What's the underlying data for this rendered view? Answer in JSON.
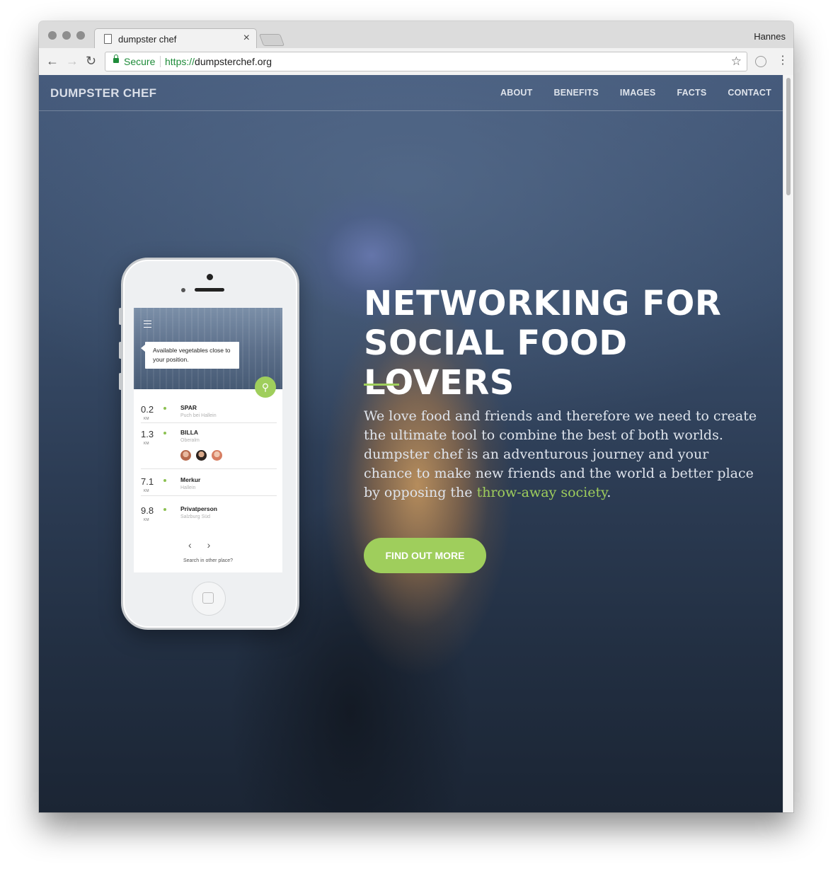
{
  "browser": {
    "tab_title": "dumpster chef",
    "tab_close": "×",
    "profile_name": "Hannes",
    "nav_back": "←",
    "nav_forward": "→",
    "nav_reload": "↻",
    "secure_label": "Secure",
    "url_scheme": "https://",
    "url_host": "dumpsterchef.org",
    "bookmark_icon": "☆",
    "menu_icon": "⋮"
  },
  "site": {
    "brand": "DUMPSTER CHEF",
    "nav": [
      "ABOUT",
      "BENEFITS",
      "IMAGES",
      "FACTS",
      "CONTACT"
    ]
  },
  "app_mockup": {
    "bubble_text": "Available vegetables close to your position.",
    "pin_icon": "⚲",
    "unit": "KM",
    "locations": [
      {
        "distance": "0.2",
        "name": "SPAR",
        "place": "Puch bei Hallein"
      },
      {
        "distance": "1.3",
        "name": "BILLA",
        "place": "Oberalm"
      },
      {
        "distance": "7.1",
        "name": "Merkur",
        "place": "Hallein"
      },
      {
        "distance": "9.8",
        "name": "Privatperson",
        "place": "Salzburg Süd"
      }
    ],
    "prev_icon": "‹",
    "next_icon": "›",
    "search_other": "Search in other place?"
  },
  "hero": {
    "title_line1": "NETWORKING FOR",
    "title_line2": "SOCIAL FOOD LOVERS",
    "text": "We love food and friends and therefore we need to create the ultimate tool to combine the best of both worlds. dumpster chef is an adventurous journey and your chance to make new friends and the world a better place by opposing the ",
    "text_highlight": "throw-away society",
    "text_end": ".",
    "cta": "FIND OUT MORE"
  },
  "colors": {
    "accent": "#9fce5c",
    "secure_green": "#1f8c3a",
    "hero_dark": "#2c3c54"
  }
}
